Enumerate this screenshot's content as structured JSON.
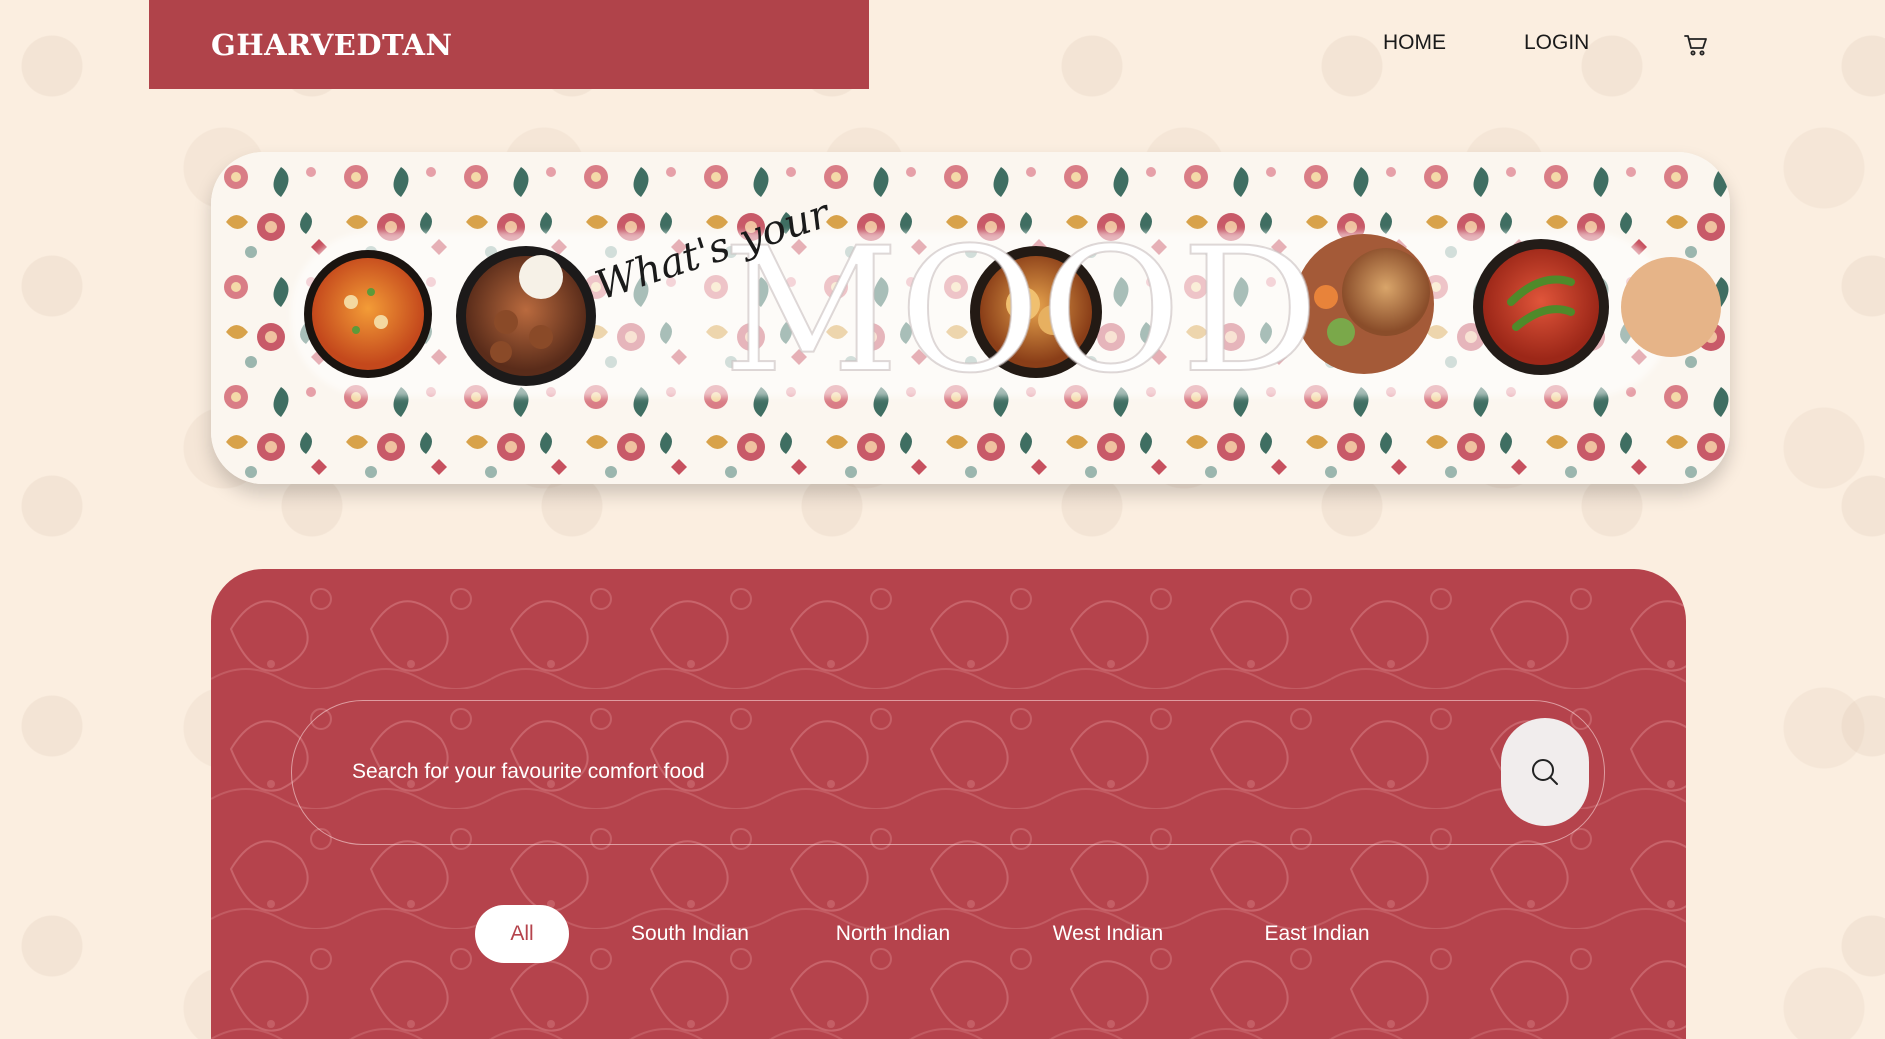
{
  "header": {
    "brand": "GHARVEDTAN",
    "nav": [
      {
        "label": "HOME"
      },
      {
        "label": "LOGIN"
      }
    ],
    "cart_icon": "cart-icon"
  },
  "banner": {
    "script_text": "What's your",
    "headline": "MOOD",
    "dishes": [
      "paneer-curry",
      "kebabs-with-raita",
      "dal-baati",
      "thali-paratha",
      "bhindi-masala"
    ]
  },
  "search": {
    "placeholder": "Search for your favourite comfort food",
    "button_icon": "search-icon"
  },
  "filters": [
    {
      "label": "All",
      "active": true
    },
    {
      "label": "South Indian",
      "active": false
    },
    {
      "label": "North Indian",
      "active": false
    },
    {
      "label": "West Indian",
      "active": false
    },
    {
      "label": "East Indian",
      "active": false
    }
  ],
  "colors": {
    "brand": "#b0434a",
    "page_bg": "#fbeee0",
    "panel": "#b5434c"
  }
}
